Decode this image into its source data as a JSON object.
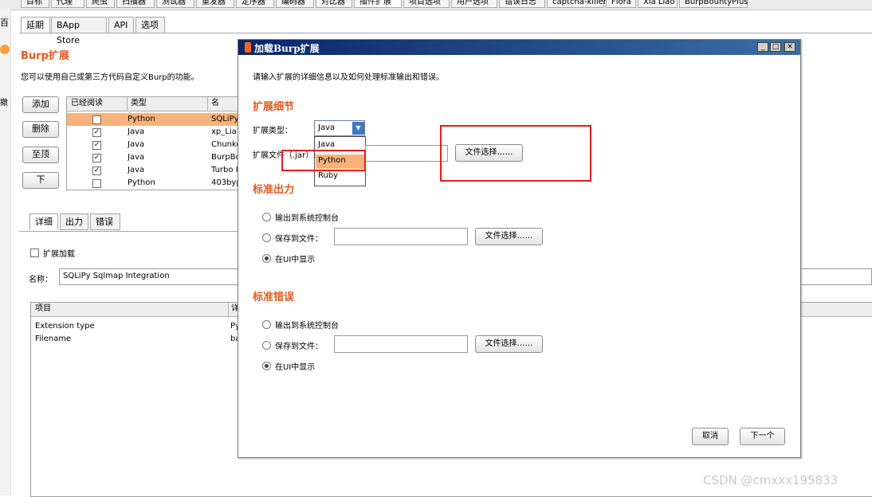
{
  "top_tabs": [
    "目标",
    "代理",
    "爬虫",
    "扫描器",
    "测试器",
    "重发器",
    "定序器",
    "编码器",
    "对比器",
    "插件扩展",
    "项目选项",
    "用户选项",
    "错误日志",
    "captcha-killer",
    "Flora",
    "Xia Liao",
    "BurpBountyPlus"
  ],
  "left_strip": {
    "text1": "百",
    "text2": "撤"
  },
  "sub_tabs": [
    "延期",
    "BApp Store",
    "API",
    "选项"
  ],
  "section": {
    "title": "Burp扩展",
    "description": "您可以使用自己或第三方代码自定义Burp的功能。"
  },
  "buttons": {
    "add": "添加",
    "remove": "删除",
    "top": "至顶",
    "down": "下"
  },
  "ext_table": {
    "headers": [
      "已经阅读",
      "类型",
      "名"
    ],
    "rows": [
      {
        "loaded": false,
        "type": "Python",
        "name": "SQLiPy"
      },
      {
        "loaded": true,
        "type": "Java",
        "name": "xp_Lia"
      },
      {
        "loaded": true,
        "type": "Java",
        "name": "Chunke"
      },
      {
        "loaded": true,
        "type": "Java",
        "name": "BurpBo"
      },
      {
        "loaded": true,
        "type": "Java",
        "name": "Turbo I"
      },
      {
        "loaded": false,
        "type": "Python",
        "name": "403byp"
      }
    ]
  },
  "detail_tabs": [
    "详细",
    "出力",
    "错误"
  ],
  "detail": {
    "loaded_label": "扩展加载",
    "name_label": "名称：",
    "name_value": "SQLiPy Sqlmap Integration",
    "table_headers": [
      "项目",
      "详"
    ],
    "rows": [
      {
        "item": "Extension type",
        "value": "Py"
      },
      {
        "item": "Filename",
        "value": "ba"
      }
    ]
  },
  "dialog": {
    "title": "加载Burp扩展",
    "intro": "请输入扩展的详细信息以及如何处理标准输出和错误。",
    "details_heading": "扩展细节",
    "type_label": "扩展类型：",
    "type_selected": "Java",
    "type_options": [
      "Java",
      "Python",
      "Ruby"
    ],
    "file_label": "扩展文件（.jar）:",
    "file_button": "文件选择……",
    "stdout_heading": "标准出力",
    "stderr_heading": "标准错误",
    "opt_console": "输出到系统控制台",
    "opt_save": "保存到文件：",
    "opt_ui": "在UI中显示",
    "cancel": "取消",
    "next": "下一个"
  },
  "watermark": "CSDN @cmxxx195833",
  "colors": {
    "accent_orange": "#e35a1c",
    "highlight_row": "#f7b37a",
    "title_bar": "#0a246a",
    "annotation_red": "#e81c1c"
  }
}
